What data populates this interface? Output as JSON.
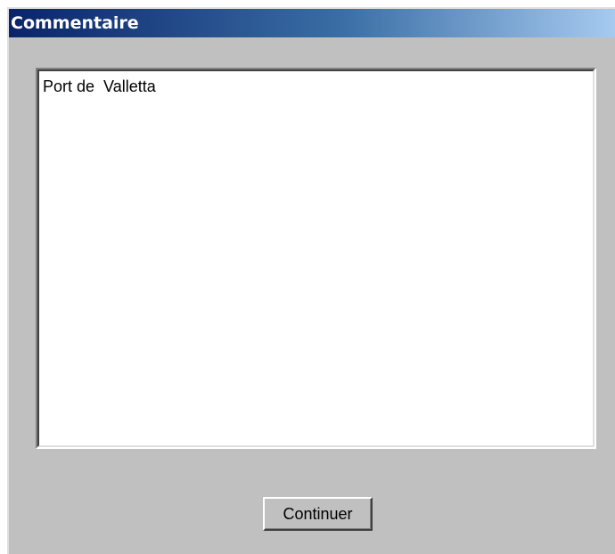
{
  "window": {
    "title": "Commentaire"
  },
  "comment": {
    "value": "Port de  Valletta"
  },
  "actions": {
    "continue_label": "Continuer"
  },
  "colors": {
    "titlebar_start": "#0a246a",
    "titlebar_end": "#a6caf0",
    "dialog_background": "#c0c0c0",
    "field_background": "#ffffff"
  }
}
